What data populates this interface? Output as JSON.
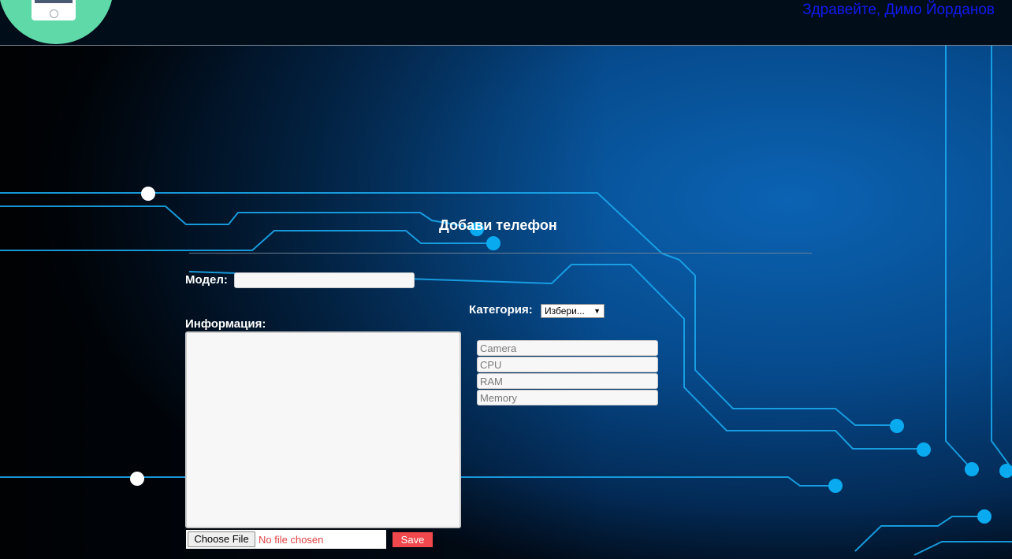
{
  "header": {
    "greeting": "Здравейте, Димо Йорданов",
    "logo_icon": "phone-icon"
  },
  "form": {
    "title": "Добави телефон",
    "model_label": "Модел:",
    "model_value": "",
    "info_label": "Информация:",
    "info_value": "",
    "category_label": "Категория:",
    "category_selected": "Избери...",
    "specs": [
      {
        "placeholder": "Camera",
        "value": ""
      },
      {
        "placeholder": "CPU",
        "value": ""
      },
      {
        "placeholder": "RAM",
        "value": ""
      },
      {
        "placeholder": "Memory",
        "value": ""
      }
    ],
    "file_button_label": "Choose File",
    "file_status": "No file chosen",
    "save_label": "Save"
  },
  "colors": {
    "header_bg": "#020d1a",
    "logo_green": "#5fd9a8",
    "greeting_blue": "#0f1aee",
    "save_red": "#f0484c",
    "circuit_cyan": "#1aa7ec"
  }
}
